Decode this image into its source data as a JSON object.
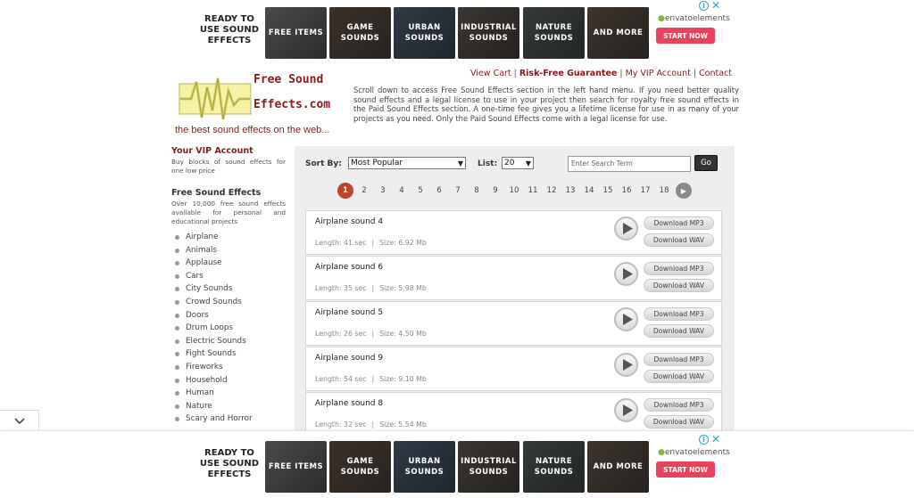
{
  "ad": {
    "ready_text": "READY TO USE SOUND EFFECTS",
    "tiles": [
      "FREE ITEMS",
      "GAME SOUNDS",
      "URBAN SOUNDS",
      "INDUSTRIAL SOUNDS",
      "NATURE SOUNDS",
      "AND MORE"
    ],
    "brand": "envatoelements",
    "cta": "START NOW",
    "info_icon": "info-icon",
    "close_icon": "close-icon"
  },
  "header": {
    "logo_line1": "Free Sound",
    "logo_line2": "Effects.com",
    "tagline": "the best sound effects on the web...",
    "nav": [
      "View Cart",
      "Risk-Free Guarantee",
      "My VIP Account",
      "Contact"
    ],
    "intro": "Scroll down to access Free Sound Effects section in the left hand menu. If you need better quality sound effects and a legal license to use in your project then search for royalty free sound effects in the Paid Sound Effects section. A one-time fee gives you a lifetime license for use in as many of your projects as you need. Only the Paid Sound Effects come with a legal license for use."
  },
  "sidebar": {
    "vip_title": "Your VIP Account",
    "vip_desc": "Buy blocks of sound effects for one low price",
    "free_title": "Free Sound Effects",
    "free_desc": "Over 10,000 free sound effects available for personal and educational projects",
    "categories": [
      "Airplane",
      "Animals",
      "Applause",
      "Cars",
      "City Sounds",
      "Crowd Sounds",
      "Doors",
      "Drum Loops",
      "Electric Sounds",
      "Fight Sounds",
      "Fireworks",
      "Household",
      "Human",
      "Nature",
      "Scary and Horror"
    ]
  },
  "controls": {
    "sort_label": "Sort By:",
    "sort_value": "Most Popular",
    "list_label": "List:",
    "list_value": "20",
    "search_placeholder": "Enter Search Term",
    "go_label": "Go"
  },
  "pager": {
    "pages": [
      "1",
      "2",
      "3",
      "4",
      "5",
      "6",
      "7",
      "8",
      "9",
      "10",
      "11",
      "12",
      "13",
      "14",
      "15",
      "16",
      "17",
      "18"
    ],
    "current": "1",
    "next_icon": "next-arrow-icon"
  },
  "results": [
    {
      "title": "Airplane sound 4",
      "length": "Length: 41 sec",
      "size": "Size: 6.92 Mb"
    },
    {
      "title": "Airplane sound 6",
      "length": "Length: 35 sec",
      "size": "Size: 5.98 Mb"
    },
    {
      "title": "Airplane sound 5",
      "length": "Length: 26 sec",
      "size": "Size: 4.50 Mb"
    },
    {
      "title": "Airplane sound 9",
      "length": "Length: 54 sec",
      "size": "Size: 9.10 Mb"
    },
    {
      "title": "Airplane sound 8",
      "length": "Length: 32 sec",
      "size": "Size: 5.54 Mb"
    }
  ],
  "buttons": {
    "mp3": "Download MP3",
    "wav": "Download WAV"
  },
  "colors": {
    "brand_red": "#8b1a1a",
    "cta_pink": "#e8435c",
    "page_current": "#c0442c"
  }
}
